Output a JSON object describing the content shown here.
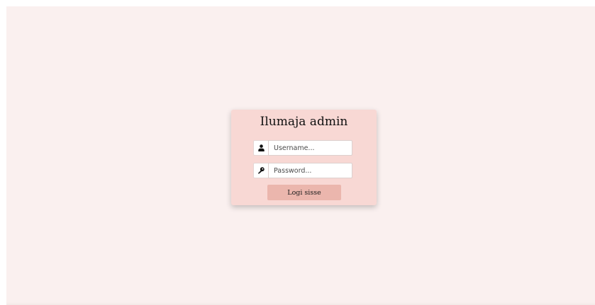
{
  "login": {
    "title": "Ilumaja admin",
    "username": {
      "icon": "user-icon",
      "placeholder": "Username...",
      "value": ""
    },
    "password": {
      "icon": "key-icon",
      "placeholder": "Password...",
      "value": ""
    },
    "submit_label": "Logi sisse"
  },
  "colors": {
    "background": "#faf0ef",
    "card": "#f8d8d4",
    "button": "#ebb6ad"
  }
}
